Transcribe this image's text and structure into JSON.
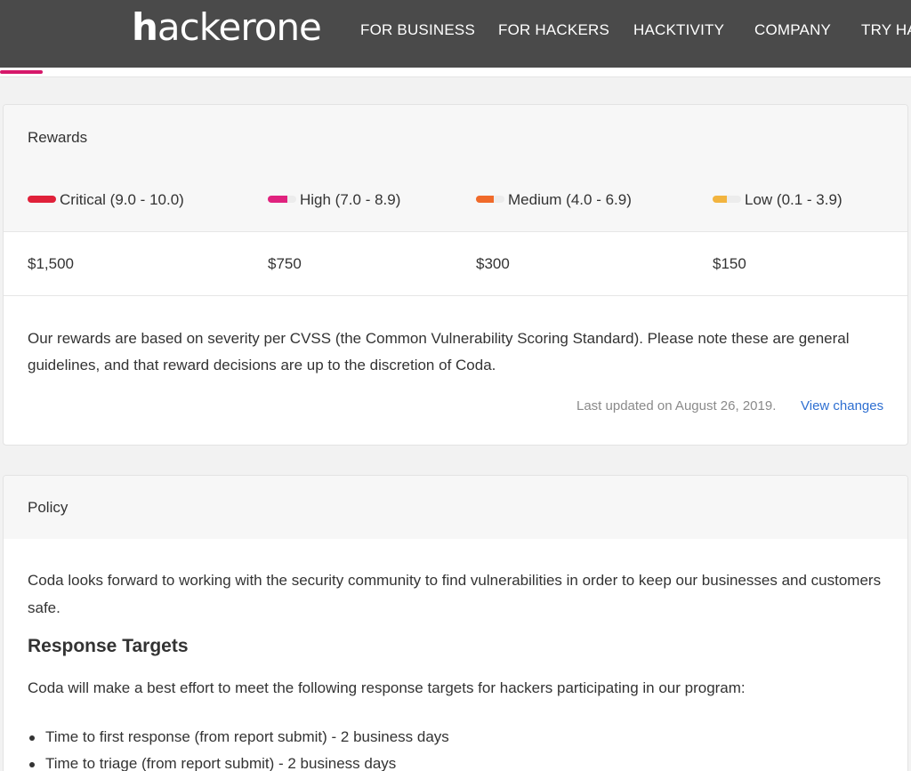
{
  "header": {
    "logo_left": "h",
    "logo_right": "ackerone",
    "nav": [
      {
        "label": "FOR BUSINESS"
      },
      {
        "label": "FOR HACKERS"
      },
      {
        "label": "HACKTIVITY"
      },
      {
        "label": "COMPANY"
      },
      {
        "label": "TRY HA"
      }
    ]
  },
  "rewards": {
    "title": "Rewards",
    "severities": [
      {
        "label": "Critical (9.0 - 10.0)",
        "amount": "$1,500",
        "color": "#e0213a",
        "fill": 1.0
      },
      {
        "label": "High (7.0 - 8.9)",
        "amount": "$750",
        "color": "#e0227e",
        "fill": 0.7
      },
      {
        "label": "Medium (4.0 - 6.9)",
        "amount": "$300",
        "color": "#f06a2a",
        "fill": 0.6
      },
      {
        "label": "Low (0.1 - 3.9)",
        "amount": "$150",
        "color": "#f2b43f",
        "fill": 0.5
      }
    ],
    "note": "Our rewards are based on severity per CVSS (the Common Vulnerability Scoring Standard). Please note these are general guidelines, and that reward decisions are up to the discretion of Coda.",
    "last_updated": "Last updated on August 26, 2019.",
    "view_changes": "View changes"
  },
  "policy": {
    "title": "Policy",
    "intro": "Coda looks forward to working with the security community to find vulnerabilities in order to keep our businesses and customers safe.",
    "heading": "Response Targets",
    "paragraph": "Coda will make a best effort to meet the following response targets for hackers participating in our program:",
    "items": [
      "Time to first response (from report submit) - 2 business days",
      "Time to triage (from report submit) - 2 business days"
    ]
  },
  "colors": {
    "header_bg": "#4a4a4a",
    "accent": "#d6186a",
    "link": "#2e6fd1"
  }
}
